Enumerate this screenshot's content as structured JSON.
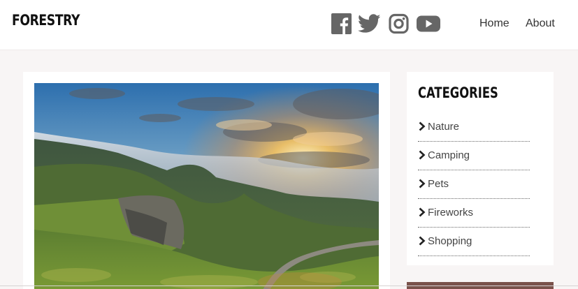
{
  "header": {
    "brand": "FORESTRY",
    "social": [
      {
        "icon": "facebook-icon"
      },
      {
        "icon": "twitter-icon"
      },
      {
        "icon": "instagram-icon"
      },
      {
        "icon": "youtube-icon"
      }
    ],
    "nav": [
      {
        "label": "Home"
      },
      {
        "label": "About"
      }
    ]
  },
  "main": {
    "hero_image": {
      "icon": "landscape-photo",
      "subject": "misty green hills at sunset with winding road"
    }
  },
  "sidebar": {
    "title": "CATEGORIES",
    "categories": [
      {
        "label": "Nature"
      },
      {
        "label": "Camping"
      },
      {
        "label": "Pets"
      },
      {
        "label": "Fireworks"
      },
      {
        "label": "Shopping"
      }
    ]
  },
  "colors": {
    "background": "#f8f5f5",
    "icon_gray": "#666666",
    "accent_brown": "#7a524b"
  }
}
